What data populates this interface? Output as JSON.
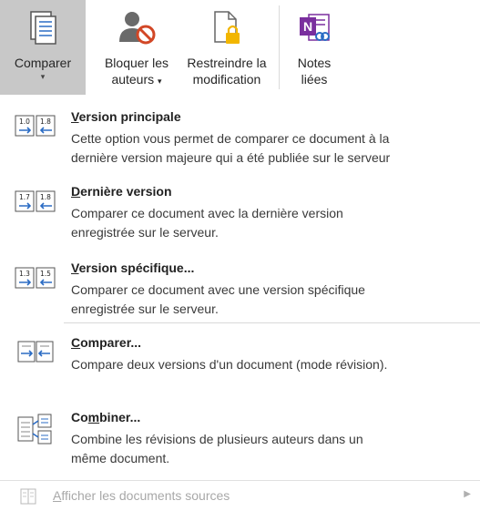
{
  "ribbon": {
    "compare": {
      "label": "Comparer",
      "caret": "▾"
    },
    "block": {
      "line1": "Bloquer les",
      "line2": "auteurs",
      "caret": "▾"
    },
    "restrict": {
      "line1": "Restreindre la",
      "line2": "modification"
    },
    "notes": {
      "line1": "Notes",
      "line2": "liées"
    }
  },
  "menu": {
    "items": [
      {
        "icon": "compare-version-major-icon",
        "title_access": "V",
        "title_rest": "ersion principale",
        "desc1": "Cette option vous permet de comparer ce document à la",
        "desc2": "dernière version majeure qui a été publiée sur le serveur",
        "badge_left": "1.0",
        "badge_right": "1.8"
      },
      {
        "icon": "compare-version-last-icon",
        "title_access": "D",
        "title_rest": "ernière version",
        "desc1": "Comparer ce document avec la dernière version",
        "desc2": "enregistrée sur le serveur.",
        "badge_left": "1.7",
        "badge_right": "1.8"
      },
      {
        "icon": "compare-version-specific-icon",
        "title_access": "V",
        "title_rest": "ersion spécifique...",
        "desc1": "Comparer ce document avec une version spécifique",
        "desc2": "enregistrée sur le serveur.",
        "badge_left": "1.3",
        "badge_right": "1.5"
      },
      {
        "icon": "compare-docs-icon",
        "title_access": "C",
        "title_rest": "omparer...",
        "desc1": "Compare deux versions d'un document (mode révision).",
        "desc2": ""
      },
      {
        "icon": "combine-docs-icon",
        "title_pre": "Co",
        "title_access": "m",
        "title_rest": "biner...",
        "desc1": "Combine les révisions de plusieurs auteurs dans un",
        "desc2": "même document."
      }
    ],
    "footer": {
      "access": "A",
      "rest": "fficher les documents sources",
      "arrow": "▶"
    }
  },
  "colors": {
    "active_bg": "#c8c8c8",
    "onenote_purple": "#7a2f9e",
    "arrow_blue": "#2b6cc4",
    "disabled_text": "#a8a8a8"
  }
}
